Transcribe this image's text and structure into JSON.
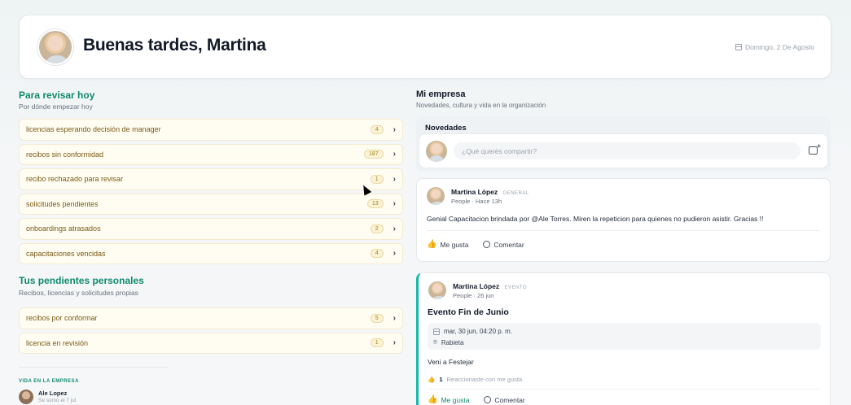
{
  "header": {
    "greeting": "Buenas tardes, Martina",
    "date": "Domingo, 2 De Agosto"
  },
  "review": {
    "title": "Para revisar hoy",
    "subtitle": "Por dónde empezar hoy",
    "items": [
      {
        "label": "licencias esperando decisión de manager",
        "count": "4"
      },
      {
        "label": "recibos sin conformidad",
        "count": "187"
      },
      {
        "label": "recibo rechazado para revisar",
        "count": "1"
      },
      {
        "label": "solicitudes pendientes",
        "count": "13"
      },
      {
        "label": "onboardings atrasados",
        "count": "2"
      },
      {
        "label": "capacitaciones vencidas",
        "count": "4"
      }
    ]
  },
  "personal": {
    "title": "Tus pendientes personales",
    "subtitle": "Recibos, licencias y solicitudes propias",
    "items": [
      {
        "label": "recibos por conformar",
        "count": "5"
      },
      {
        "label": "licencia en revisión",
        "count": "1"
      }
    ]
  },
  "vida": {
    "label": "VIDA EN LA EMPRESA",
    "name": "Ale Lopez",
    "sub": "Se sumó el 7 jul"
  },
  "empresa": {
    "title": "Mi empresa",
    "subtitle": "Novedades, cultura y vida en la organización",
    "novedades_label": "Novedades",
    "composer_placeholder": "¿Qué querés compartir?"
  },
  "posts": [
    {
      "author": "Martina López",
      "tag": "GENERAL",
      "meta": "People · Hace 13h",
      "body": "Genial Capacitacion brindada por @Ale Torres.  Miren la repeticion para quienes no pudieron asistir.  Gracias !!",
      "like": "Me gusta",
      "comment": "Comentar"
    },
    {
      "author": "Martina López",
      "tag": "EVENTO",
      "meta": "People · 26 jun",
      "title": "Evento Fin de Junio",
      "when": "mar, 30 jun, 04:20 p. m.",
      "where": "Rabieta",
      "body": "Veni a Festejar",
      "reaction_count": "1",
      "reaction_text": "Reaccionaste con me gusta",
      "like": "Me gusta",
      "comment": "Comentar"
    }
  ],
  "colors": {
    "accent": "#0f8a6f",
    "event_border": "#14b8a6",
    "task_bg": "#fffdf2"
  }
}
